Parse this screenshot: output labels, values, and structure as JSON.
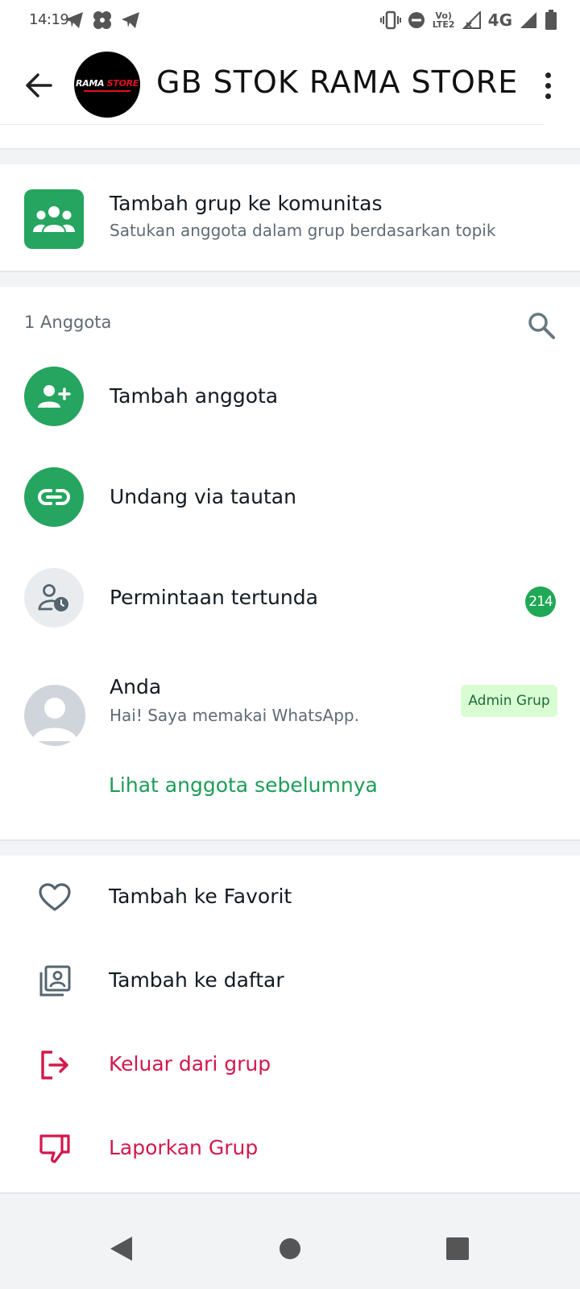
{
  "status_bar": {
    "time": "14:19",
    "network_label": "4G",
    "volte_label": "Vo) LTE2",
    "icons": [
      "telegram-icon",
      "pinwheel-icon",
      "telegram-icon",
      "vibrate-icon",
      "do-not-disturb-icon",
      "volte-icon",
      "signal-icon",
      "network-icon",
      "battery-icon"
    ]
  },
  "header": {
    "group_name": "GB STOK RAMA STORE",
    "avatar_logo_prefix": "RAMA",
    "avatar_logo_suffix": "STORE",
    "back_icon": "arrow-left-icon",
    "menu_icon": "more-vert-icon"
  },
  "community": {
    "title": "Tambah grup ke komunitas",
    "subtitle": "Satukan anggota dalam grup berdasarkan topik",
    "icon": "community-icon"
  },
  "members": {
    "count_label": "1 Anggota",
    "search_icon": "search-icon",
    "add_member_label": "Tambah anggota",
    "invite_link_label": "Undang via tautan",
    "pending_label": "Permintaan tertunda",
    "pending_count": "214",
    "self": {
      "name": "Anda",
      "status": "Hai! Saya memakai WhatsApp.",
      "role": "Admin Grup"
    },
    "see_previous_label": "Lihat anggota sebelumnya"
  },
  "actions": [
    {
      "label": "Tambah ke Favorit",
      "icon": "heart-icon",
      "danger": false
    },
    {
      "label": "Tambah ke daftar",
      "icon": "list-add-icon",
      "danger": false
    },
    {
      "label": "Keluar dari grup",
      "icon": "exit-icon",
      "danger": true
    },
    {
      "label": "Laporkan Grup",
      "icon": "thumbs-down-icon",
      "danger": true
    }
  ],
  "colors": {
    "accent_green": "#25a55f",
    "danger_red": "#d3184c",
    "admin_tag_bg": "#d9fdd3"
  }
}
